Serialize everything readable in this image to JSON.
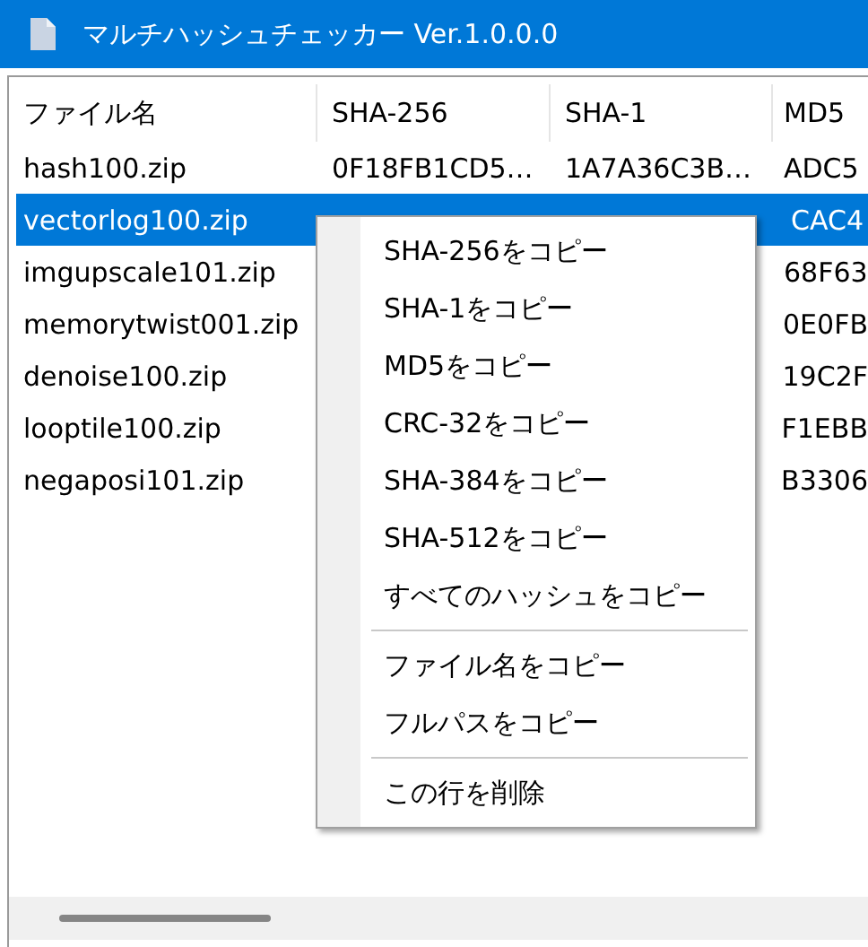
{
  "window": {
    "title": "マルチハッシュチェッカー Ver.1.0.0.0"
  },
  "table": {
    "columns": [
      "ファイル名",
      "SHA-256",
      "SHA-1",
      "MD5"
    ],
    "rows": [
      {
        "file": "hash100.zip",
        "sha256": "0F18FB1CD5…",
        "sha1": "1A7A36C3B…",
        "md5": "ADC5",
        "selected": false
      },
      {
        "file": "vectorlog100.zip",
        "md5": "CAC4",
        "selected": true
      },
      {
        "file": "imgupscale101.zip",
        "md5": "68F63",
        "selected": false
      },
      {
        "file": "memorytwist001.zip",
        "md5": "0E0FB",
        "selected": false
      },
      {
        "file": "denoise100.zip",
        "md5": "19C2F",
        "selected": false
      },
      {
        "file": "looptile100.zip",
        "md5": "F1EBB",
        "selected": false
      },
      {
        "file": "negaposi101.zip",
        "md5": "B3306",
        "selected": false
      }
    ]
  },
  "context_menu": {
    "groups": [
      [
        "SHA-256をコピー",
        "SHA-1をコピー",
        "MD5をコピー",
        "CRC-32をコピー",
        "SHA-384をコピー",
        "SHA-512をコピー",
        "すべてのハッシュをコピー"
      ],
      [
        "ファイル名をコピー",
        "フルパスをコピー"
      ],
      [
        "この行を削除"
      ]
    ]
  }
}
